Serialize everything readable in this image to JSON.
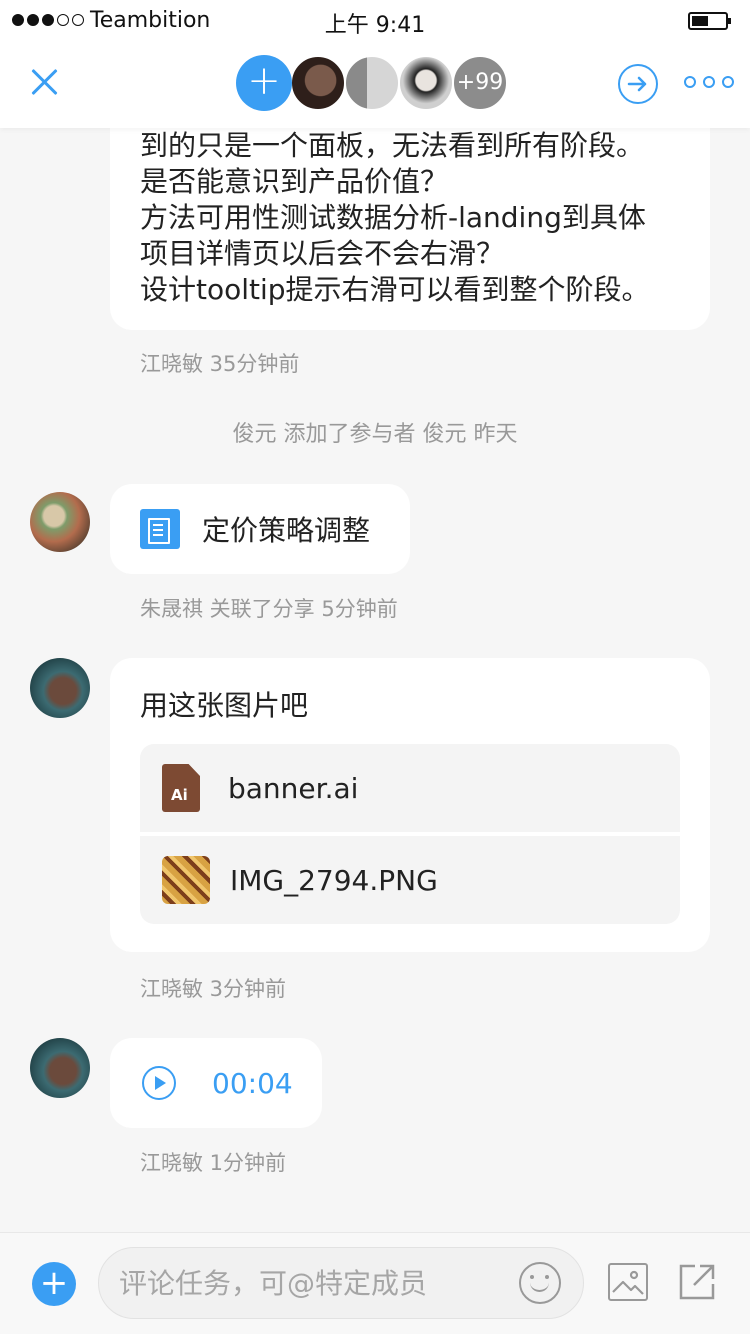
{
  "status_bar": {
    "carrier": "Teambition",
    "time": "上午 9:41",
    "battery_level": 0.5
  },
  "header": {
    "add_member": "+",
    "more_count": "+99"
  },
  "feed": {
    "message_1": {
      "lines": [
        "到的只是一个面板，无法看到所有阶段。",
        "是否能意识到产品价值？",
        "方法可用性测试数据分析-landing到具体",
        "项目详情页以后会不会右滑？",
        "设计tooltip提示右滑可以看到整个阶段。"
      ],
      "meta": "江晓敏 35分钟前"
    },
    "system_note": "俊元 添加了参与者 俊元 昨天",
    "share": {
      "title": "定价策略调整",
      "meta": "朱晟祺 关联了分享 5分钟前"
    },
    "message_2": {
      "text": "用这张图片吧",
      "files": [
        {
          "name": "banner.ai",
          "icon": "ai-file-icon",
          "badge": "Ai"
        },
        {
          "name": "IMG_2794.PNG",
          "icon": "image-thumbnail"
        }
      ],
      "meta": "江晓敏 3分钟前"
    },
    "voice": {
      "duration": "00:04",
      "meta": "江晓敏 1分钟前"
    }
  },
  "composer": {
    "placeholder": "评论任务，可@特定成员"
  },
  "colors": {
    "accent": "#3a9ef3",
    "meta_text": "#999999"
  }
}
